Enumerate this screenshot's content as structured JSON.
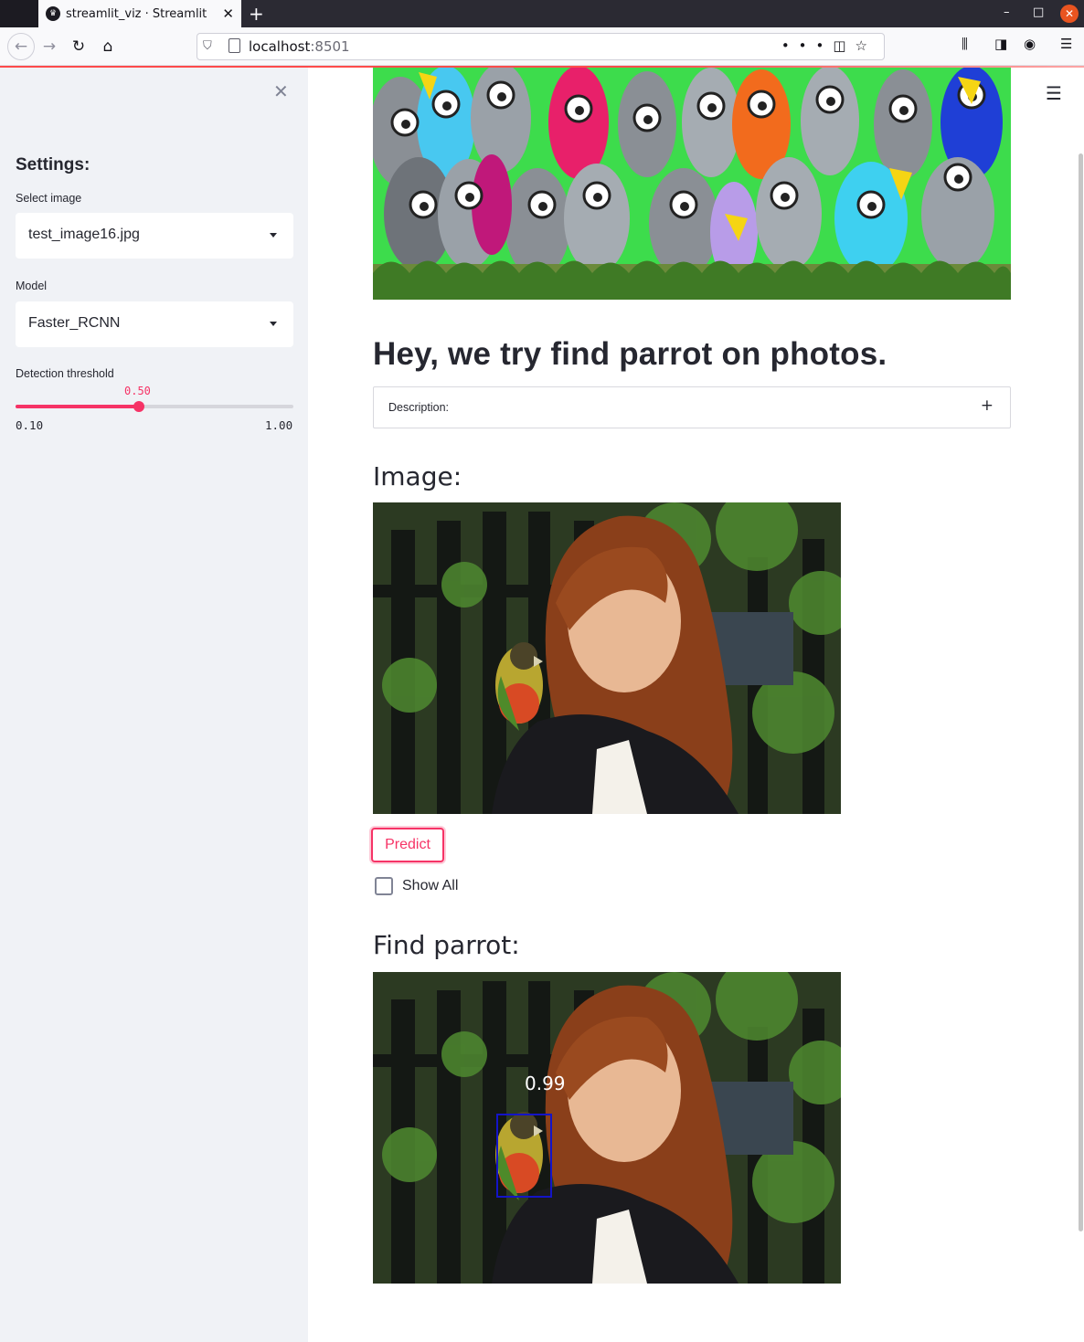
{
  "browser": {
    "tab_title": "streamlit_viz · Streamlit",
    "url_host": "localhost",
    "url_port": ":8501",
    "minimize_glyph": "–",
    "maximize_glyph": "□",
    "close_glyph": "✕",
    "new_tab_glyph": "+"
  },
  "sidebar": {
    "close_glyph": "✕",
    "heading": "Settings:",
    "select_image": {
      "label": "Select image",
      "value": "test_image16.jpg"
    },
    "model": {
      "label": "Model",
      "value": "Faster_RCNN"
    },
    "threshold": {
      "label": "Detection threshold",
      "value": 0.5,
      "value_text": "0.50",
      "min": 0.1,
      "max": 1.0,
      "min_text": "0.10",
      "max_text": "1.00"
    }
  },
  "main": {
    "menu_glyph": "☰",
    "title": "Hey, we try find parrot on photos.",
    "expander": {
      "label": "Description:",
      "glyph": "+"
    },
    "image_heading": "Image:",
    "predict_label": "Predict",
    "show_all_label": "Show All",
    "show_all_checked": false,
    "result_heading": "Find parrot:",
    "detection": {
      "score": "0.99"
    }
  },
  "colors": {
    "accent": "#f63366",
    "sidebar_bg": "#f0f2f6",
    "text": "#262730",
    "detection_box": "#1414c8"
  }
}
